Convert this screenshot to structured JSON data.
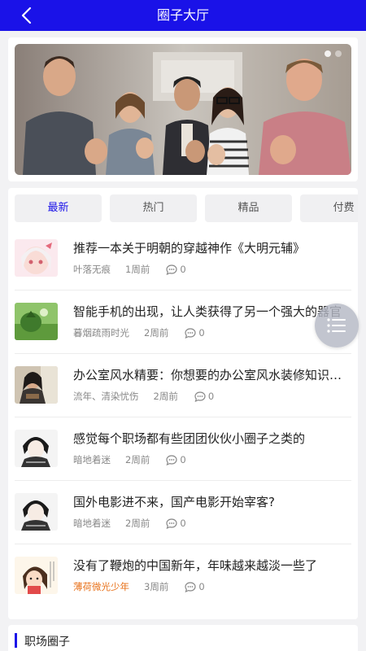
{
  "header": {
    "title": "圈子大厅"
  },
  "tabs": [
    {
      "label": "最新",
      "active": true
    },
    {
      "label": "热门",
      "active": false
    },
    {
      "label": "精品",
      "active": false
    },
    {
      "label": "付费",
      "active": false
    }
  ],
  "posts": [
    {
      "title": "推荐一本关于明朝的穿越神作《大明元辅》",
      "author": "叶落无痕",
      "time": "1周前",
      "comments": "0"
    },
    {
      "title": "智能手机的出现，让人类获得了另一个强大的器官",
      "author": "暮烟疏雨时光",
      "time": "2周前",
      "comments": "0"
    },
    {
      "title": "办公室风水精要：你想要的办公室风水装修知识都在这里",
      "author": "流年、清染忧伤",
      "time": "2周前",
      "comments": "0"
    },
    {
      "title": "感觉每个职场都有些团团伙伙小圈子之类的",
      "author": "暗地着迷",
      "time": "2周前",
      "comments": "0"
    },
    {
      "title": "国外电影进不来，国产电影开始宰客?",
      "author": "暗地着迷",
      "time": "2周前",
      "comments": "0"
    },
    {
      "title": "没有了鞭炮的中国新年，年味越来越淡一些了",
      "author": "薄荷微光少年",
      "time": "3周前",
      "comments": "0",
      "author_highlight": true
    }
  ],
  "section": {
    "title": "职场圈子"
  },
  "colors": {
    "primary": "#1a12e8",
    "highlight_author": "#e8711a"
  },
  "icons": {
    "back": "back-arrow-icon",
    "comment": "comment-bubble-icon",
    "menu": "menu-icon"
  }
}
